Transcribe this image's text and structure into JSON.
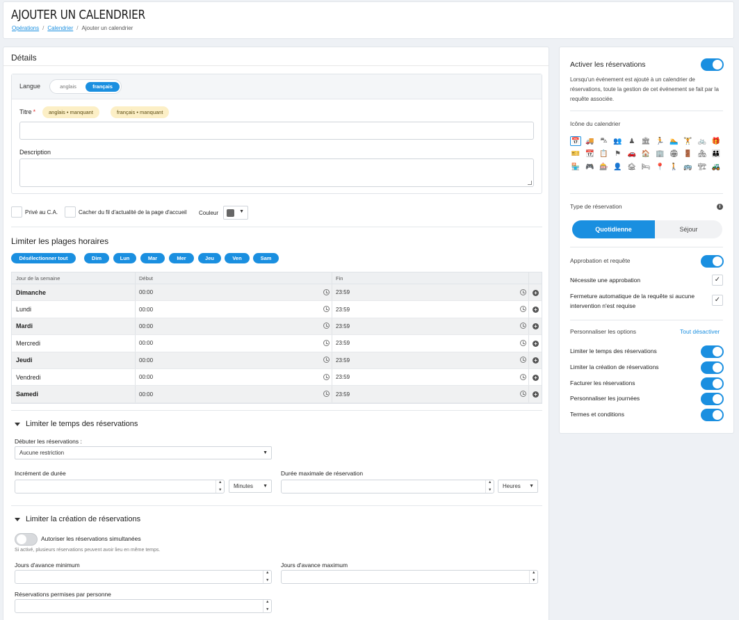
{
  "header": {
    "title": "AJOUTER UN CALENDRIER",
    "breadcrumb": [
      "Opérations",
      "Calendrier",
      "Ajouter un calendrier"
    ]
  },
  "details": {
    "title": "Détails",
    "language_label": "Langue",
    "languages": [
      "anglais",
      "français"
    ],
    "selected_language": "français",
    "title_label": "Titre",
    "missing_pills": [
      "anglais • manquant",
      "français • manquant"
    ],
    "title_value": "",
    "description_label": "Description",
    "description_value": "",
    "private_label": "Privé au C.A.",
    "hide_feed_label": "Cacher du fil d'actualité de la page d'accueil",
    "color_label": "Couleur",
    "color_value": "#666666"
  },
  "hours": {
    "title": "Limiter les plages horaires",
    "deselect_all": "Désélectionner tout",
    "day_buttons": [
      "Dim",
      "Lun",
      "Mar",
      "Mer",
      "Jeu",
      "Ven",
      "Sam"
    ],
    "columns": [
      "Jour de la semaine",
      "Début",
      "Fin"
    ],
    "rows": [
      {
        "day": "Dimanche",
        "start": "00:00",
        "end": "23:59"
      },
      {
        "day": "Lundi",
        "start": "00:00",
        "end": "23:59"
      },
      {
        "day": "Mardi",
        "start": "00:00",
        "end": "23:59"
      },
      {
        "day": "Mercredi",
        "start": "00:00",
        "end": "23:59"
      },
      {
        "day": "Jeudi",
        "start": "00:00",
        "end": "23:59"
      },
      {
        "day": "Vendredi",
        "start": "00:00",
        "end": "23:59"
      },
      {
        "day": "Samedi",
        "start": "00:00",
        "end": "23:59"
      }
    ]
  },
  "limit_time": {
    "title": "Limiter le temps des réservations",
    "start_label": "Débuter les réservations :",
    "start_value": "Aucune restriction",
    "increment_label": "Incrément de durée",
    "increment_unit": "Minutes",
    "max_label": "Durée maximale de réservation",
    "max_unit": "Heures"
  },
  "limit_creation": {
    "title": "Limiter la création de réservations",
    "simultaneous_label": "Autoriser les réservations simultanées",
    "simultaneous_hint": "Si activé, plusieurs réservations peuvent avoir lieu en même temps.",
    "min_days_label": "Jours d'avance minimum",
    "max_days_label": "Jours d'avance maximum",
    "per_person_label": "Réservations permises par personne"
  },
  "sidebar": {
    "activate_label": "Activer les réservations",
    "activate_desc": "Lorsqu'un événement est ajouté à un calendrier de réservations, toute la gestion de cet événement se fait par la requête associée.",
    "icon_label": "Icône du calendrier",
    "icons": [
      "📅",
      "🚚",
      "⛍",
      "👥",
      "♟",
      "🏛",
      "🏃",
      "🏊",
      "🏋",
      "🚲",
      "🎁",
      "🎫",
      "📆",
      "📋",
      "⚑",
      "🚗",
      "🏠",
      "🏢",
      "🏟",
      "🚪",
      "🏘",
      "👪",
      "🏪",
      "🎮",
      "🎰",
      "👤",
      "🏚",
      "🛏",
      "📍",
      "🚶",
      "🚌",
      "🏗",
      "🚜"
    ],
    "type_label": "Type de réservation",
    "type_options": [
      "Quotidienne",
      "Séjour"
    ],
    "approval_label": "Approbation et requête",
    "needs_approval": "Nécessite une approbation",
    "auto_close": "Fermeture automatique de la requête si aucune intervention n'est requise",
    "customize_label": "Personnaliser les options",
    "disable_all": "Tout désactiver",
    "options": [
      "Limiter le temps des réservations",
      "Limiter la création de réservations",
      "Facturer les réservations",
      "Personnaliser les journées",
      "Termes et conditions"
    ]
  }
}
